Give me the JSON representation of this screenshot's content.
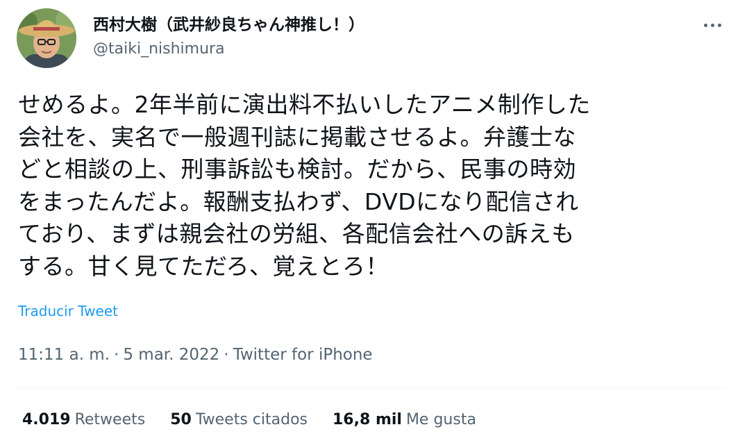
{
  "author": {
    "display_name": "西村大樹（武井紗良ちゃん神推し！）",
    "handle": "@taiki_nishimura"
  },
  "tweet": {
    "text": "せめるよ。2年半前に演出料不払いしたアニメ制作した\n会社を、実名で一般週刊誌に掲載させるよ。弁護士な\nどと相談の上、刑事訴訟も検討。だから、民事の時効\nをまったんだよ。報酬支払わず、DVDになり配信され\nており、まずは親会社の労組、各配信会社への訴えも\nする。甘く見てただろ、覚えとろ！",
    "translate_label": "Traducir Tweet"
  },
  "meta": {
    "time": "11:11 a. m.",
    "separator": "·",
    "date": "5 mar. 2022",
    "source": "Twitter for iPhone"
  },
  "stats": {
    "retweets": {
      "count": "4.019",
      "label": "Retweets"
    },
    "quotes": {
      "count": "50",
      "label": "Tweets citados"
    },
    "likes": {
      "count": "16,8 mil",
      "label": "Me gusta"
    }
  },
  "icons": {
    "more": "more-horizontal-icon",
    "avatar": "avatar-photo"
  },
  "colors": {
    "link": "#1d9bf0",
    "secondary_text": "#536471",
    "primary_text": "#0f1419",
    "divider": "#eff3f4"
  }
}
